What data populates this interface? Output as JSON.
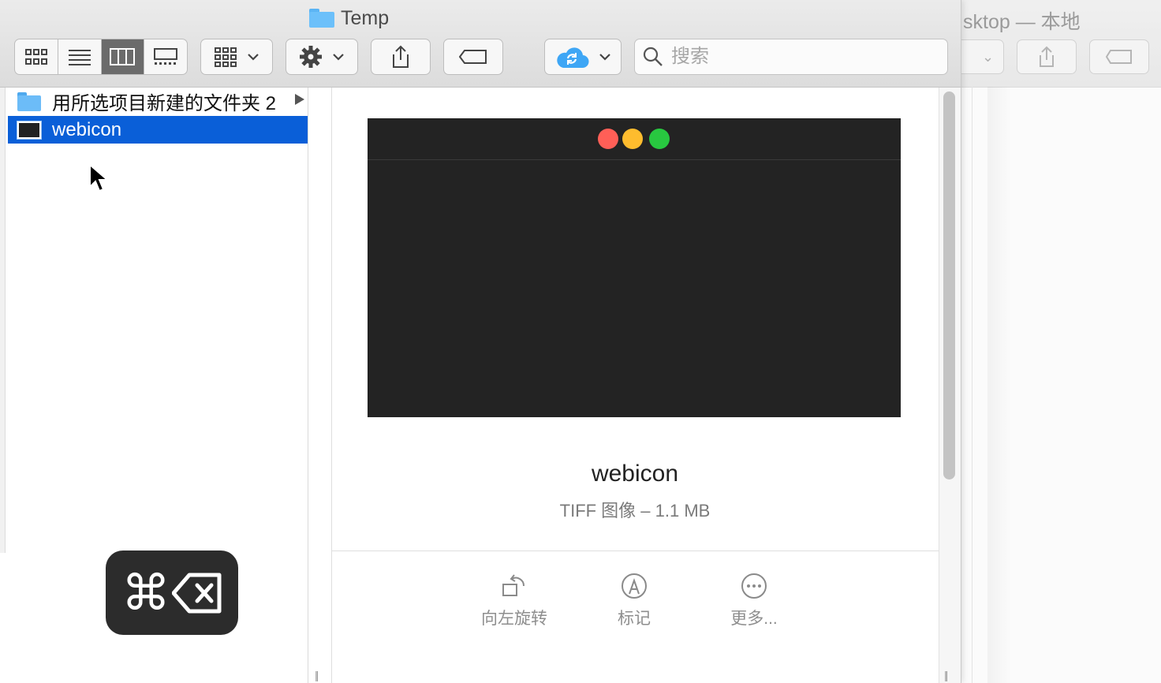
{
  "background_window": {
    "title": "sktop — 本地"
  },
  "window": {
    "title": "Temp"
  },
  "toolbar": {
    "view_buttons": [
      "icon-view-icon",
      "list-view-icon",
      "column-view-icon",
      "gallery-view-icon"
    ],
    "active_view": "column-view-icon",
    "search_placeholder": "搜索"
  },
  "column1": {
    "items": [
      {
        "label": "用所选项目新建的文件夹 2",
        "icon": "folder-icon",
        "has_children": true,
        "selected": false
      },
      {
        "label": "webicon",
        "icon": "image-file-icon",
        "has_children": false,
        "selected": true
      }
    ]
  },
  "preview": {
    "file_name": "webicon",
    "file_info": "TIFF 图像 – 1.1 MB",
    "traffic_lights": [
      "#ff5f57",
      "#febc2e",
      "#28c840"
    ],
    "actions": [
      {
        "label": "向左旋转",
        "icon": "rotate-left-icon"
      },
      {
        "label": "标记",
        "icon": "markup-icon"
      },
      {
        "label": "更多...",
        "icon": "more-icon"
      }
    ]
  },
  "shortcut_overlay": {
    "keys": "⌘⌫",
    "command_symbol": "⌘"
  },
  "colors": {
    "selection": "#0a5fd8",
    "folder": "#6cbcf8"
  }
}
